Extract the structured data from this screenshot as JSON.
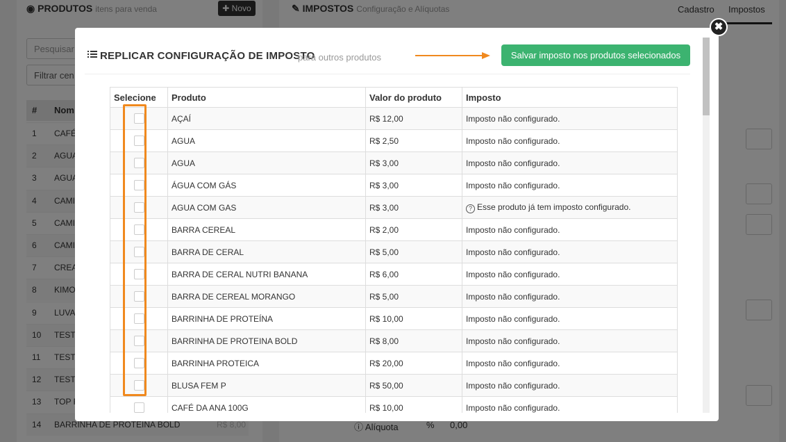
{
  "background": {
    "products_title": "PRODUTOS",
    "products_subtitle": "itens para venda",
    "new_button": "✚ Novo",
    "search_placeholder": "Pesquisar",
    "filter_label": "Filtrar cen",
    "table_header_num": "#",
    "table_header_name": "Nom",
    "rows": [
      {
        "n": "1",
        "name": "CAFÉ"
      },
      {
        "n": "2",
        "name": "AGUA"
      },
      {
        "n": "3",
        "name": "AGUA"
      },
      {
        "n": "4",
        "name": "CAMIS"
      },
      {
        "n": "5",
        "name": "CAMIS"
      },
      {
        "n": "6",
        "name": "CAMIS"
      },
      {
        "n": "7",
        "name": "CREAT"
      },
      {
        "n": "8",
        "name": "KIMO"
      },
      {
        "n": "9",
        "name": "LUVA"
      },
      {
        "n": "10",
        "name": "TESTE"
      },
      {
        "n": "11",
        "name": "TESTE"
      },
      {
        "n": "12",
        "name": "TESTE"
      },
      {
        "n": "13",
        "name": "TOP F"
      },
      {
        "n": "14",
        "name": "BARRINHA DE PROTEINA BOLD"
      }
    ],
    "row14_price": "R$ 8,00",
    "taxes_title": "IMPOSTOS",
    "taxes_subtitle": "Configuração e Alíquotas",
    "tab_register": "Cadastro",
    "tab_taxes": "Impostos",
    "aliquota_label": "Alíquota",
    "aliquota_unit": "%",
    "aliquota_value": "0,00"
  },
  "modal": {
    "title": "REPLICAR CONFIGURAÇÃO DE IMPOSTO",
    "subtitle": "para outros produtos",
    "save_button": "Salvar imposto nos produtos selecionados",
    "close_icon": "✖",
    "columns": [
      "Selecione",
      "Produto",
      "Valor do produto",
      "Imposto"
    ],
    "rows": [
      {
        "product": "AÇAÍ",
        "price": "R$ 12,00",
        "tax": "Imposto não configurado."
      },
      {
        "product": "AGUA",
        "price": "R$ 2,50",
        "tax": "Imposto não configurado."
      },
      {
        "product": "AGUA",
        "price": "R$ 3,00",
        "tax": "Imposto não configurado."
      },
      {
        "product": "ÁGUA COM GÁS",
        "price": "R$ 3,00",
        "tax": "Imposto não configurado."
      },
      {
        "product": "AGUA COM GAS",
        "price": "R$ 3,00",
        "tax": "Esse produto já tem imposto configurado."
      },
      {
        "product": "BARRA CEREAL",
        "price": "R$ 2,00",
        "tax": "Imposto não configurado."
      },
      {
        "product": "BARRA DE CERAL",
        "price": "R$ 5,00",
        "tax": "Imposto não configurado."
      },
      {
        "product": "BARRA DE CERAL NUTRI BANANA",
        "price": "R$ 6,00",
        "tax": "Imposto não configurado."
      },
      {
        "product": "BARRA DE CEREAL MORANGO",
        "price": "R$ 5,00",
        "tax": "Imposto não configurado."
      },
      {
        "product": "BARRINHA DE PROTEÍNA",
        "price": "R$ 10,00",
        "tax": "Imposto não configurado."
      },
      {
        "product": "BARRINHA DE PROTEINA BOLD",
        "price": "R$ 8,00",
        "tax": "Imposto não configurado."
      },
      {
        "product": "BARRINHA PROTEICA",
        "price": "R$ 20,00",
        "tax": "Imposto não configurado."
      },
      {
        "product": "BLUSA FEM P",
        "price": "R$ 50,00",
        "tax": "Imposto não configurado."
      },
      {
        "product": "CAFÉ DA ANA 100G",
        "price": "R$ 10,00",
        "tax": "Imposto não configurado."
      }
    ]
  },
  "colors": {
    "save_button": "#3cb370",
    "highlight": "#f0891e"
  }
}
